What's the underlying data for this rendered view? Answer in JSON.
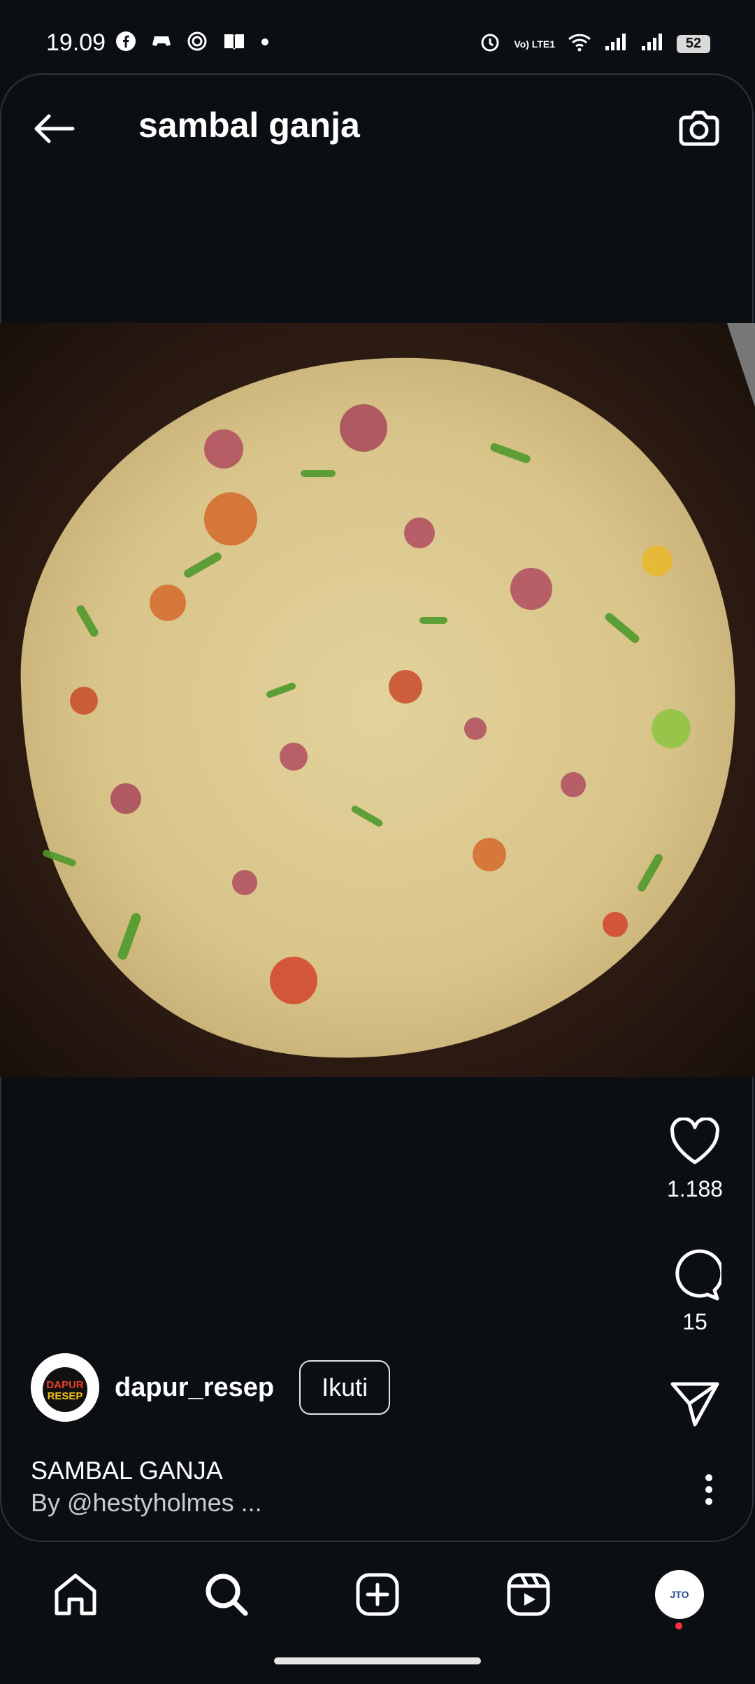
{
  "status": {
    "time": "19.09",
    "battery": "52",
    "left_icons": [
      "facebook-icon",
      "game-icon",
      "target-icon",
      "book-icon",
      "dot-icon"
    ],
    "right_icons": [
      "alarm-icon",
      "volte-icon",
      "wifi-icon",
      "signal-icon",
      "signal2-icon"
    ],
    "volte_label": "Vo) LTE1"
  },
  "header": {
    "title": "sambal ganja",
    "back_icon": "arrow-left-icon",
    "camera_icon": "camera-icon"
  },
  "post": {
    "image_icon": "food-photo",
    "likes": "1.188",
    "comments": "15",
    "author": "dapur_resep",
    "avatar_text": "DAPUR RESEP",
    "follow_label": "Ikuti",
    "caption_line1": "SAMBAL GANJA",
    "caption_line2": "By @hestyholmes ..."
  },
  "nav": {
    "items": [
      "home-icon",
      "search-icon",
      "add-icon",
      "reels-icon",
      "profile-avatar"
    ],
    "profile_text": "JTO"
  }
}
